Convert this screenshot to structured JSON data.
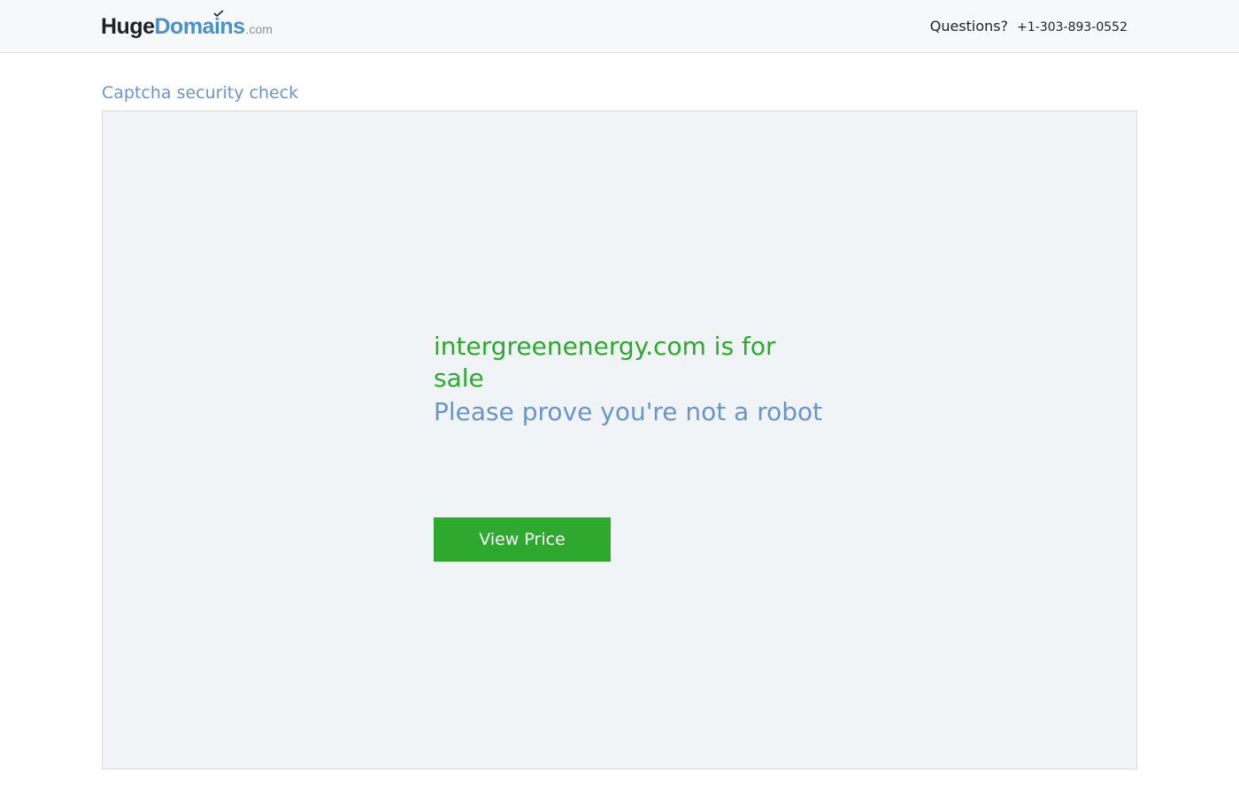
{
  "header": {
    "logo": {
      "part1": "Huge",
      "part2": "Domains",
      "part3": ".com",
      "colors": {
        "huge": "#222222",
        "domains": "#4a90c9",
        "tld": "#8a8f96"
      }
    },
    "questions_label": "Questions?",
    "phone": "+1-303-893-0552"
  },
  "main": {
    "page_title": "Captcha security check",
    "headline": "intergreenenergy.com is for sale",
    "subheadline": "Please prove you're not a robot",
    "button_label": "View Price"
  },
  "colors": {
    "accent_green": "#2ea82e",
    "accent_blue": "#6b95c9",
    "panel_background": "#f0f4f7"
  }
}
